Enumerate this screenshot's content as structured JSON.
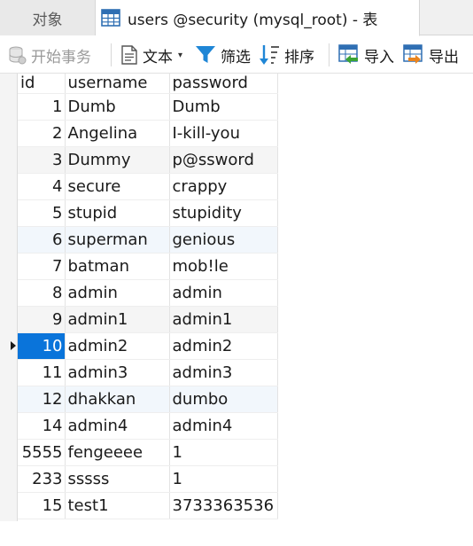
{
  "tabs": {
    "objects_label": "对象",
    "table_label": "users @security (mysql_root) - 表"
  },
  "toolbar": {
    "begin_transaction": "开始事务",
    "text": "文本",
    "filter": "筛选",
    "sort": "排序",
    "import": "导入",
    "export": "导出"
  },
  "grid": {
    "columns": [
      "id",
      "username",
      "password"
    ],
    "rows": [
      {
        "id": "1",
        "username": "Dumb",
        "password": "Dumb"
      },
      {
        "id": "2",
        "username": "Angelina",
        "password": "I-kill-you"
      },
      {
        "id": "3",
        "username": "Dummy",
        "password": "p@ssword"
      },
      {
        "id": "4",
        "username": "secure",
        "password": "crappy"
      },
      {
        "id": "5",
        "username": "stupid",
        "password": "stupidity"
      },
      {
        "id": "6",
        "username": "superman",
        "password": "genious"
      },
      {
        "id": "7",
        "username": "batman",
        "password": "mob!le"
      },
      {
        "id": "8",
        "username": "admin",
        "password": "admin"
      },
      {
        "id": "9",
        "username": "admin1",
        "password": "admin1"
      },
      {
        "id": "10",
        "username": "admin2",
        "password": "admin2"
      },
      {
        "id": "11",
        "username": "admin3",
        "password": "admin3"
      },
      {
        "id": "12",
        "username": "dhakkan",
        "password": "dumbo"
      },
      {
        "id": "14",
        "username": "admin4",
        "password": "admin4"
      },
      {
        "id": "5555",
        "username": "fengeeee",
        "password": "1"
      },
      {
        "id": "233",
        "username": "sssss",
        "password": "1"
      },
      {
        "id": "15",
        "username": "test1",
        "password": "3733363536"
      }
    ],
    "selected_row_index": 9,
    "selected_color": "#0a74da"
  },
  "icons": {
    "table_tab": "table-grid-icon",
    "begin_transaction": "database-icon",
    "text": "document-icon",
    "filter": "funnel-icon",
    "sort": "sort-arrow-icon",
    "import": "import-table-icon",
    "export": "export-table-icon"
  }
}
